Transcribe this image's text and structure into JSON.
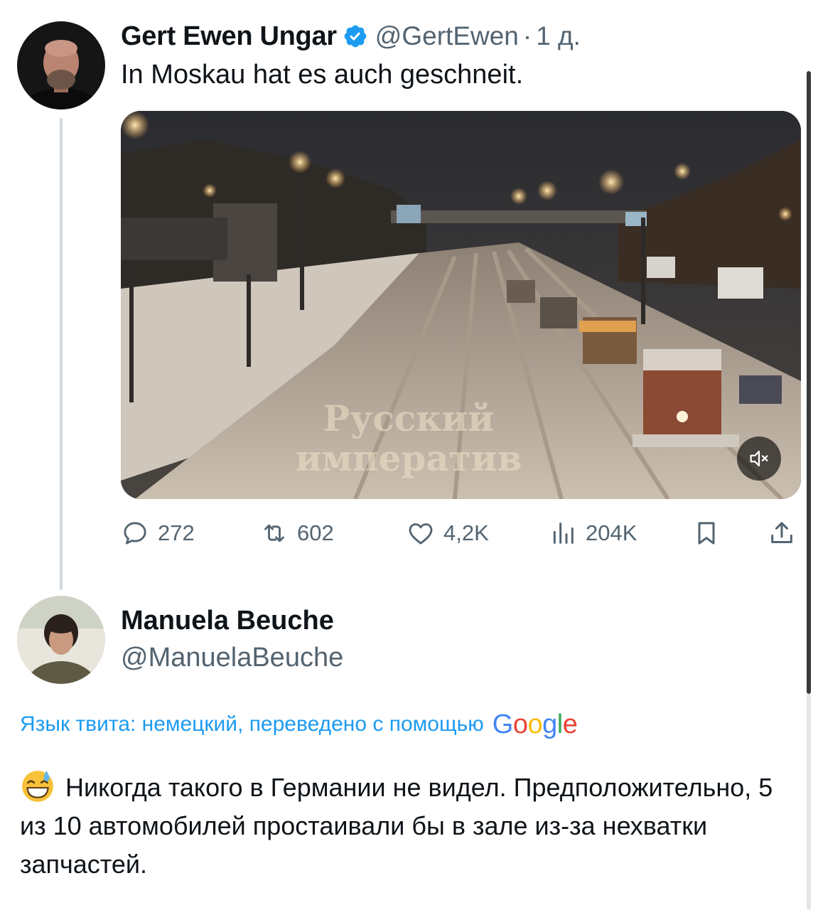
{
  "tweet": {
    "author_name": "Gert Ewen Ungar",
    "author_handle": "@GertEwen",
    "separator": "·",
    "time": "1 д.",
    "text": "In Moskau hat es auch geschneit.",
    "media": {
      "watermark_line1": "Русский",
      "watermark_line2": "императив",
      "mute_icon": "speaker-muted-icon"
    },
    "actions": {
      "replies": "272",
      "retweets": "602",
      "likes": "4,2K",
      "views": "204K"
    }
  },
  "reply": {
    "author_name": "Manuela Beuche",
    "author_handle": "@ManuelaBeuche",
    "translation_note": "Язык твита: немецкий, переведено с помощью",
    "translation_provider": "Google",
    "emoji": "grinning-face-with-sweat",
    "text": "Никогда такого в Германии не видел. Предположительно, 5 из 10 автомобилей простаивали бы в зале из-за нехватки запчастей."
  },
  "colors": {
    "link_blue": "#1d9bf0",
    "muted_gray": "#536471",
    "text_dark": "#0f1419",
    "thread_line": "#cfd9de"
  }
}
